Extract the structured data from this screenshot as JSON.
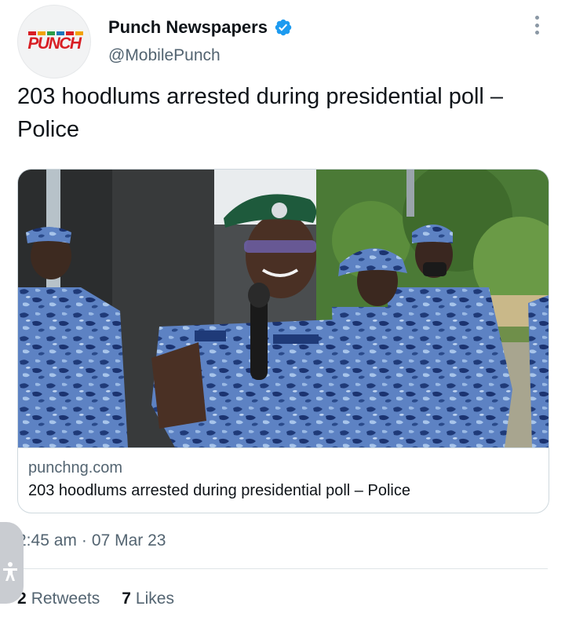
{
  "tweet": {
    "author": {
      "display_name": "Punch Newspapers",
      "handle": "@MobilePunch",
      "verified": true,
      "avatar_logo_text": "PUNCH"
    },
    "text": "203 hoodlums arrested during presidential poll – Police",
    "link_card": {
      "domain": "punchng.com",
      "title": "203 hoodlums arrested during presidential poll – Police"
    },
    "time": "2:45 am",
    "separator": "·",
    "date": "07 Mar 23",
    "stats": {
      "retweets_count": "2",
      "retweets_label": "Retweets",
      "likes_count": "7",
      "likes_label": "Likes"
    }
  },
  "icons": {
    "verified": "verified-badge-icon",
    "more": "more-options-icon",
    "accessibility": "accessibility-icon"
  },
  "colors": {
    "verified_blue": "#1d9bf0",
    "secondary_text": "#536471",
    "primary_text": "#0f1419",
    "brand_red": "#d81e24",
    "uniform_blue": "#5f84c4",
    "beret_green": "#1e5a3c"
  }
}
